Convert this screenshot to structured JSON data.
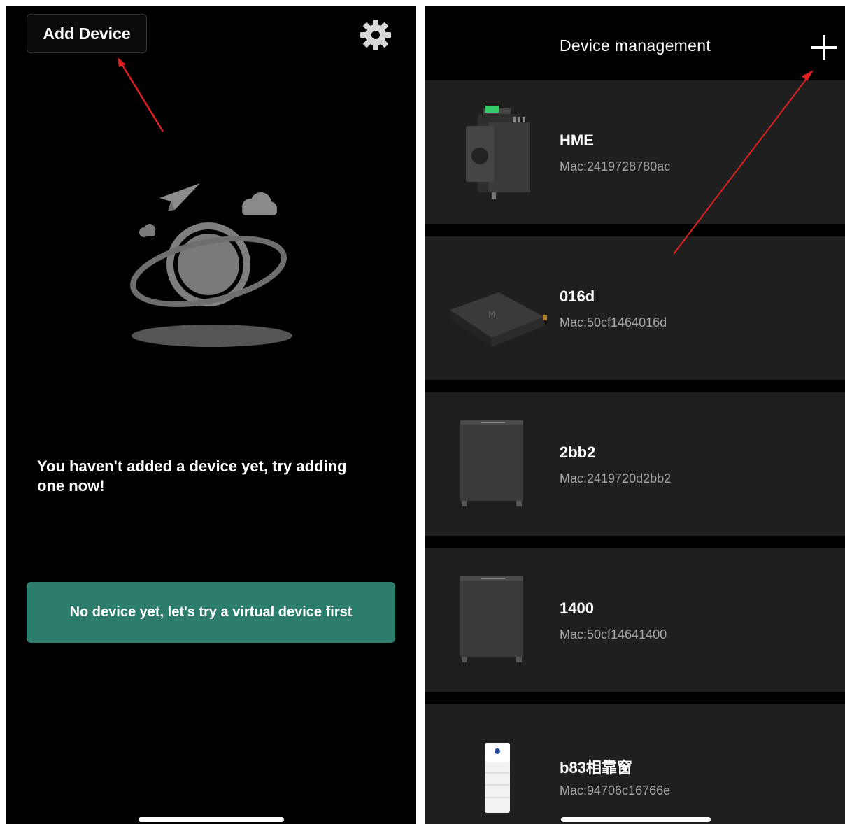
{
  "left_screen": {
    "add_device_label": "Add Device",
    "empty_message": "You haven't added a device yet, try adding one now!",
    "virtual_device_label": "No device yet, let's try a virtual device first",
    "accent_color": "#2d7d6d"
  },
  "right_screen": {
    "title": "Device management",
    "add_icon": "plus-icon",
    "devices": [
      {
        "name": "HME",
        "mac": "Mac:2419728780ac",
        "icon": "din-rail-meter"
      },
      {
        "name": "016d",
        "mac": "Mac:50cf1464016d",
        "icon": "gateway-box"
      },
      {
        "name": "2bb2",
        "mac": "Mac:2419720d2bb2",
        "icon": "battery-cabinet"
      },
      {
        "name": "1400",
        "mac": "Mac:50cf14641400",
        "icon": "battery-cabinet"
      },
      {
        "name": "b83相靠窗",
        "mac": "Mac:94706c16766e",
        "icon": "stacked-battery"
      }
    ]
  }
}
